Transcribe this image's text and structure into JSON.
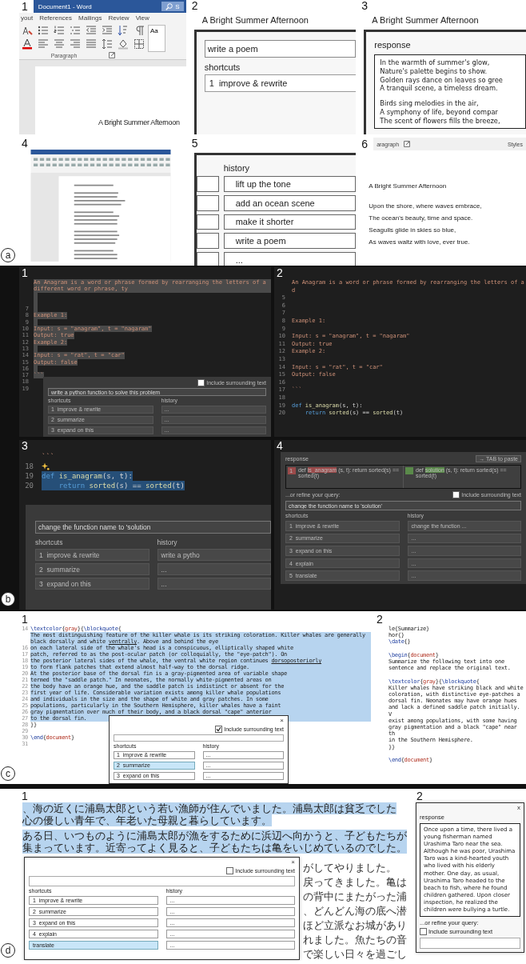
{
  "sections": [
    {
      "letter": "a",
      "panels": [
        {
          "number": "1",
          "kind": "word_window",
          "title": "Document1  -  Word",
          "search": "S",
          "tabs": [
            "yout",
            "References",
            "Mailings",
            "Review",
            "View"
          ],
          "group_label": "Paragraph",
          "style_preview": "Aa",
          "doc_title": "A Bright Summer Afternoon"
        },
        {
          "number": "2",
          "kind": "doc_dialog",
          "doc_title": "A Bright Summer Afternoon",
          "dialog": {
            "query": "write a poem",
            "shortcuts_label": "shortcuts",
            "shortcuts": [
              {
                "number": "1",
                "label": "improve & rewrite",
                "selected": false
              }
            ]
          }
        },
        {
          "number": "3",
          "kind": "doc_dialog",
          "doc_title": "A Bright Summer Afternoon",
          "dialog": {
            "response_label": "response",
            "response_stanzas": [
              [
                "In the warmth of summer's glow,",
                "Nature's palette begins to show.",
                "Golden rays dance on leaves so gree",
                "A tranquil scene, a timeless dream."
              ],
              [
                "Birds sing melodies in the air,",
                "A symphony of life, beyond compar",
                "The scent of flowers fills the breeze,"
              ]
            ]
          }
        },
        {
          "number": "4",
          "kind": "word_thumbnail"
        },
        {
          "number": "5",
          "kind": "doc_dialog",
          "dialog": {
            "history_label": "history",
            "shortcuts": [
              {
                "selected": false
              },
              {
                "selected": false
              },
              {
                "selected": false
              },
              {
                "selected": false
              },
              {
                "selected": false
              }
            ],
            "history": [
              "lift up the tone",
              "add an ocean scene",
              "make it shorter",
              "write a poem",
              "..."
            ]
          }
        },
        {
          "number": "6",
          "kind": "word_result",
          "ribbon_labels": [
            "aragraph",
            "Styles"
          ],
          "doc_title": "A Bright Summer Afternoon",
          "lines": [
            "Upon the shore, where waves embrace,",
            "The ocean's beauty, time and space.",
            "Seagulls glide in skies so blue,",
            "As waves waltz with love, ever true."
          ]
        }
      ]
    },
    {
      "letter": "b",
      "panels": [
        {
          "number": "1",
          "kind": "code_editor",
          "lines": [
            {
              "kind": "code",
              "selected": true,
              "parts": [
                {
                  "kind": "string",
                  "text": "An Anagram is a word or phrase formed by rearranging the letters of a different word or phrase, ty"
                }
              ]
            },
            {
              "kind": "code",
              "selected": true
            },
            {
              "kind": "code",
              "selected": true
            },
            {
              "kind": "code",
              "n": "7",
              "selected": true
            },
            {
              "kind": "code",
              "n": "8",
              "selected": true,
              "parts": [
                {
                  "kind": "string",
                  "text": "Example 1:"
                }
              ]
            },
            {
              "kind": "code",
              "n": "9",
              "selected": true
            },
            {
              "kind": "code",
              "n": "10",
              "selected": true,
              "parts": [
                {
                  "kind": "string",
                  "text": "Input: s = \"anagram\", t = \"nagaram\""
                }
              ]
            },
            {
              "kind": "code",
              "n": "11",
              "selected": true,
              "parts": [
                {
                  "kind": "string",
                  "text": "Output: true"
                }
              ]
            },
            {
              "kind": "code",
              "n": "12",
              "selected": true,
              "parts": [
                {
                  "kind": "string",
                  "text": "Example 2:"
                }
              ]
            },
            {
              "kind": "code",
              "n": "13",
              "selected": true
            },
            {
              "kind": "code",
              "n": "14",
              "selected": true,
              "parts": [
                {
                  "kind": "string",
                  "text": "Input: s = \"rat\", t = \"car\""
                }
              ]
            },
            {
              "kind": "code",
              "n": "15",
              "selected": true,
              "parts": [
                {
                  "kind": "string",
                  "text": "Output: false"
                }
              ]
            },
            {
              "kind": "code",
              "n": "16",
              "selected": true
            },
            {
              "kind": "code",
              "n": "17",
              "selected": true,
              "parts": [
                {
                  "kind": "string",
                  "text": "```"
                }
              ]
            },
            {
              "kind": "code",
              "n": "18",
              "selected": false
            },
            {
              "kind": "code",
              "n": "19",
              "selected": false
            }
          ],
          "dialog": {
            "include": {
              "label": "Include surrounding text",
              "checked": false
            },
            "query": "write a python function to solve this problem",
            "shortcuts_label": "shortcuts",
            "history_label": "history",
            "shortcuts": [
              {
                "number": "1",
                "label": "improve & rewrite",
                "selected": false
              },
              {
                "number": "2",
                "label": "summarize",
                "selected": false
              },
              {
                "number": "3",
                "label": "expand on this",
                "selected": false
              }
            ],
            "history": [
              "...",
              "...",
              "..."
            ]
          }
        },
        {
          "number": "2",
          "kind": "code_editor",
          "lines": [
            {
              "kind": "code",
              "selected": false,
              "parts": [
                {
                  "kind": "string",
                  "text": "An Anagram is a word or phrase formed by rearranging the letters of a d"
                }
              ]
            },
            {
              "kind": "code",
              "n": "5",
              "selected": false
            },
            {
              "kind": "code",
              "n": "6",
              "selected": false
            },
            {
              "kind": "code",
              "n": "7",
              "selected": false
            },
            {
              "kind": "code",
              "n": "8",
              "selected": false,
              "parts": [
                {
                  "kind": "string",
                  "text": "Example 1:"
                }
              ]
            },
            {
              "kind": "code",
              "n": "9",
              "selected": false
            },
            {
              "kind": "code",
              "n": "10",
              "selected": false,
              "parts": [
                {
                  "kind": "string",
                  "text": "Input: s = \"anagram\", t = \"nagaram\""
                }
              ]
            },
            {
              "kind": "code",
              "n": "11",
              "selected": false,
              "parts": [
                {
                  "kind": "string",
                  "text": "Output: true"
                }
              ]
            },
            {
              "kind": "code",
              "n": "12",
              "selected": false,
              "parts": [
                {
                  "kind": "string",
                  "text": "Example 2:"
                }
              ]
            },
            {
              "kind": "code",
              "n": "13",
              "selected": false
            },
            {
              "kind": "code",
              "n": "14",
              "selected": false,
              "parts": [
                {
                  "kind": "string",
                  "text": "Input: s = \"rat\", t = \"car\""
                }
              ]
            },
            {
              "kind": "code",
              "n": "15",
              "selected": false,
              "parts": [
                {
                  "kind": "string",
                  "text": "Output: false"
                }
              ]
            },
            {
              "kind": "code",
              "n": "16",
              "selected": false
            },
            {
              "kind": "code",
              "n": "17",
              "selected": false,
              "parts": [
                {
                  "kind": "string",
                  "text": "```"
                }
              ]
            },
            {
              "kind": "code",
              "n": "18",
              "selected": false
            },
            {
              "kind": "code",
              "n": "19",
              "selected": false,
              "parts": [
                {
                  "kind": "keyword",
                  "text": "def "
                },
                {
                  "kind": "function",
                  "text": "is_anagram"
                },
                {
                  "kind": "plain",
                  "text": "(s, t):"
                }
              ]
            },
            {
              "kind": "code",
              "n": "20",
              "selected": false,
              "parts": [
                {
                  "kind": "keyword",
                  "text": "    return"
                },
                {
                  "kind": "function",
                  "text": " sorted"
                },
                {
                  "kind": "plain",
                  "text": "(s) == "
                },
                {
                  "kind": "function",
                  "text": "sorted"
                },
                {
                  "kind": "plain",
                  "text": "(t)"
                }
              ]
            }
          ]
        },
        {
          "number": "3",
          "kind": "code_editor",
          "lines": [
            {
              "kind": "code",
              "selected": false,
              "parts": [
                {
                  "kind": "string",
                  "text": "```"
                }
              ]
            },
            {
              "kind": "suggestion",
              "n": "18",
              "selected": false
            },
            {
              "kind": "code",
              "n": "19",
              "selected": true,
              "parts": [
                {
                  "kind": "keyword",
                  "text": "def "
                },
                {
                  "kind": "function",
                  "text": "is_anagram"
                },
                {
                  "kind": "plain",
                  "text": "(s, t):"
                }
              ]
            },
            {
              "kind": "code",
              "n": "20",
              "selected": true,
              "parts": [
                {
                  "kind": "keyword",
                  "text": "    return"
                },
                {
                  "kind": "function",
                  "text": " sorted"
                },
                {
                  "kind": "plain",
                  "text": "(s) == "
                },
                {
                  "kind": "function",
                  "text": "sorted"
                },
                {
                  "kind": "plain",
                  "text": "(t)"
                }
              ]
            }
          ],
          "dialog": {
            "query": "change the function name to 'solution",
            "shortcuts_label": "shortcuts",
            "history_label": "history",
            "shortcuts": [
              {
                "number": "1",
                "label": "improve & rewrite",
                "selected": false
              },
              {
                "number": "2",
                "label": "summarize",
                "selected": false
              },
              {
                "number": "3",
                "label": "expand on this",
                "selected": false
              }
            ],
            "history": [
              "write a pytho",
              "...",
              "..."
            ]
          }
        },
        {
          "number": "4",
          "kind": "diff_dialog",
          "dialog": {
            "response_label": "response",
            "paste_button": "→ TAB to paste",
            "diff": [
              {
                "kind": "removed",
                "line_number": "1",
                "before": "def ",
                "changed": "is_anagram",
                "after": " (s, t):     return sorted(s) == sorted(t)"
              },
              {
                "kind": "added",
                "before": "def ",
                "changed": "solution",
                "after": " (s, t):     return sorted(s) == sorted(t)"
              }
            ],
            "refine_label": "...or refine your query:",
            "include": {
              "label": "Include surrounding text",
              "checked": false
            },
            "query": "change the function name to 'solution'",
            "shortcuts_label": "shortcuts",
            "history_label": "history",
            "shortcuts": [
              {
                "number": "1",
                "label": "improve & rewrite",
                "selected": false
              },
              {
                "number": "2",
                "label": "summarize",
                "selected": false
              },
              {
                "number": "3",
                "label": "expand on this",
                "selected": false
              },
              {
                "number": "4",
                "label": "explain",
                "selected": false
              },
              {
                "number": "5",
                "label": "translate",
                "selected": false
              }
            ],
            "history": [
              "change the function ...",
              "...",
              "...",
              "...",
              "..."
            ]
          }
        }
      ]
    },
    {
      "letter": "c",
      "panels": [
        {
          "number": "1",
          "kind": "latex_editor",
          "lines": [
            {
              "n": "14",
              "selected": false,
              "parts": [
                {
                  "kind": "command",
                  "text": "\\textcolor"
                },
                {
                  "kind": "plain",
                  "text": "{"
                },
                {
                  "kind": "arg",
                  "text": "gray"
                },
                {
                  "kind": "plain",
                  "text": "}{"
                },
                {
                  "kind": "command",
                  "text": "\\blockquote"
                },
                {
                  "kind": "plain",
                  "text": "{"
                }
              ]
            },
            {
              "selected": true,
              "parts": [
                {
                  "kind": "plain",
                  "text": "The most distinguishing feature of the killer whale is its striking coloration. Killer whales are generally"
                }
              ]
            },
            {
              "selected": true,
              "parts": [
                {
                  "kind": "plain",
                  "text": "black dorsally and white "
                },
                {
                  "kind": "misspelled",
                  "text": "ventrally"
                },
                {
                  "kind": "plain",
                  "text": ". Above and behind the eye"
                }
              ]
            },
            {
              "n": "16",
              "selected": true,
              "parts": [
                {
                  "kind": "plain",
                  "text": "on each lateral side of the whale's head is a conspicuous, elliptically shaped white"
                }
              ]
            },
            {
              "n": "17",
              "selected": true,
              "parts": [
                {
                  "kind": "plain",
                  "text": "patch, referred to as the post-ocular patch (or colloquially, the \"eye-patch\"). On"
                }
              ]
            },
            {
              "n": "18",
              "selected": true,
              "parts": [
                {
                  "kind": "plain",
                  "text": "the posterior lateral sides of the whale, the ventral white region continues "
                },
                {
                  "kind": "misspelled",
                  "text": "dorsoposteriorly"
                }
              ]
            },
            {
              "n": "19",
              "selected": true,
              "parts": [
                {
                  "kind": "plain",
                  "text": "to form flank patches that extend almost half-way to the dorsal ridge."
                }
              ]
            },
            {
              "n": "20",
              "selected": true,
              "parts": [
                {
                  "kind": "plain",
                  "text": "At the posterior base of the dorsal fin is a gray-pigmented area of variable shape"
                }
              ]
            },
            {
              "n": "21",
              "selected": true,
              "parts": [
                {
                  "kind": "plain",
                  "text": "termed the \"saddle patch.\" In neonates, the normally white-pigmented areas on"
                }
              ]
            },
            {
              "n": "22",
              "selected": true,
              "parts": [
                {
                  "kind": "plain",
                  "text": "the body have an orange hue, and the saddle patch is indistinct or absent for the"
                }
              ]
            },
            {
              "n": "23",
              "selected": true,
              "parts": [
                {
                  "kind": "plain",
                  "text": "first year of life. Considerable variation exists among killer whale populations"
                }
              ]
            },
            {
              "n": "24",
              "selected": true,
              "parts": [
                {
                  "kind": "plain",
                  "text": "and individuals in the size and the shape of white and gray patches. In some"
                }
              ]
            },
            {
              "n": "25",
              "selected": true,
              "parts": [
                {
                  "kind": "plain",
                  "text": "populations, particularly in the Southern Hemisphere, killer whales have a faint"
                }
              ]
            },
            {
              "n": "26",
              "selected": true,
              "parts": [
                {
                  "kind": "plain",
                  "text": "gray pigmentation over much of their body, and a black dorsal \"cape\" anterior"
                }
              ]
            },
            {
              "n": "27",
              "selected": true,
              "parts": [
                {
                  "kind": "plain",
                  "text": "to the dorsal fin."
                }
              ]
            },
            {
              "n": "28",
              "selected": false,
              "parts": [
                {
                  "kind": "plain",
                  "text": "}}"
                }
              ]
            },
            {
              "n": "29",
              "selected": false
            },
            {
              "n": "30",
              "selected": false,
              "parts": [
                {
                  "kind": "command",
                  "text": "\\end"
                },
                {
                  "kind": "plain",
                  "text": "{"
                },
                {
                  "kind": "arg",
                  "text": "document"
                },
                {
                  "kind": "plain",
                  "text": "}"
                }
              ]
            },
            {
              "n": "31",
              "selected": false
            }
          ],
          "dialog": {
            "close": "×",
            "include": {
              "label": "Include surrounding text",
              "checked": true
            },
            "query_field": true,
            "shortcuts_label": "shortcuts",
            "history_label": "history",
            "shortcuts": [
              {
                "number": "1",
                "label": "improve & rewrite",
                "selected": false
              },
              {
                "number": "2",
                "label": "summarize",
                "selected": true
              },
              {
                "number": "3",
                "label": "expand on this",
                "selected": false
              }
            ],
            "history": [
              "...",
              "...",
              "..."
            ]
          }
        },
        {
          "number": "2",
          "kind": "latex_editor",
          "blocks": [
            [
              {
                "parts": [
                  {
                    "kind": "plain",
                    "text": "le{Summarize}"
                  }
                ]
              },
              {
                "parts": [
                  {
                    "kind": "plain",
                    "text": "hor{}"
                  }
                ]
              },
              {
                "parts": [
                  {
                    "kind": "command",
                    "text": "\\date"
                  },
                  {
                    "kind": "plain",
                    "text": "{}"
                  }
                ]
              }
            ],
            [
              {
                "parts": [
                  {
                    "kind": "command",
                    "text": "\\begin"
                  },
                  {
                    "kind": "plain",
                    "text": "{"
                  },
                  {
                    "kind": "arg",
                    "text": "document"
                  },
                  {
                    "kind": "plain",
                    "text": "}"
                  }
                ]
              },
              {
                "parts": [
                  {
                    "kind": "plain",
                    "text": "Summarize the following text into one sentence and replace the original text."
                  }
                ]
              }
            ],
            [
              {
                "parts": [
                  {
                    "kind": "command",
                    "text": "\\textcolor"
                  },
                  {
                    "kind": "plain",
                    "text": "{"
                  },
                  {
                    "kind": "arg",
                    "text": "gray"
                  },
                  {
                    "kind": "plain",
                    "text": "}{"
                  },
                  {
                    "kind": "command",
                    "text": "\\blockquote"
                  },
                  {
                    "kind": "plain",
                    "text": "{"
                  }
                ]
              },
              {
                "parts": [
                  {
                    "kind": "plain",
                    "text": "Killer whales have striking black and white coloration, with distinctive eye-patches a"
                  }
                ]
              },
              {
                "parts": [
                  {
                    "kind": "plain",
                    "text": "dorsal fin. Neonates may have orange hues and lack a defined saddle patch initially. V"
                  }
                ]
              },
              {
                "parts": [
                  {
                    "kind": "plain",
                    "text": "exist among populations, with some having gray pigmentation and a black \"cape\" near th"
                  }
                ]
              },
              {
                "parts": [
                  {
                    "kind": "plain",
                    "text": "in the Southern Hemisphere."
                  }
                ]
              },
              {
                "parts": [
                  {
                    "kind": "plain",
                    "text": "}}"
                  }
                ]
              }
            ],
            [
              {
                "parts": [
                  {
                    "kind": "command",
                    "text": "\\end"
                  },
                  {
                    "kind": "plain",
                    "text": "{"
                  },
                  {
                    "kind": "arg",
                    "text": "document"
                  },
                  {
                    "kind": "plain",
                    "text": "}"
                  }
                ]
              }
            ]
          ]
        }
      ]
    },
    {
      "letter": "d",
      "panels": [
        {
          "number": "1",
          "kind": "jp_editor",
          "paragraphs": [
            {
              "selected": true,
              "lines": [
                "、海の近くに浦島太郎という若い漁師が住んでいました。浦島太郎は貧乏でした",
                "心の優しい青年で、年老いた母親と暮らしています。"
              ]
            },
            {
              "selected": true,
              "lines": [
                "ある日、いつものように浦島太郎が漁をするために浜辺へ向かうと、子どもたちが",
                "集まっています。近寄ってよく見ると、子どもたちは亀をいじめているのでした。"
              ]
            }
          ],
          "side_text": [
            "がしてやりました。",
            "戻ってきました。亀は",
            "の背中にまたがった浦",
            "、どんどん海の底へ潜",
            "ほど立派なお城があり",
            "れました。魚たちの音",
            "で楽しい日々を過ごし"
          ],
          "dialog": {
            "close": "×",
            "include": {
              "label": "Include surrounding text",
              "checked": false
            },
            "query_field": true,
            "shortcuts_label": "shortcuts",
            "history_label": "history",
            "shortcuts": [
              {
                "number": "1",
                "label": "improve & rewrite",
                "selected": false
              },
              {
                "number": "2",
                "label": "summarize",
                "selected": false
              },
              {
                "number": "3",
                "label": "expand on this",
                "selected": false
              },
              {
                "number": "4",
                "label": "explain",
                "selected": false
              },
              {
                "label": "translate",
                "selected": true
              }
            ],
            "history": [
              "...",
              "...",
              "...",
              "...",
              "..."
            ]
          }
        },
        {
          "number": "2",
          "kind": "response_dialog",
          "dialog": {
            "close": "x",
            "response_label": "response",
            "response_text": "Once upon a time, there lived a young fisherman named Urashima Taro near the sea. Although he was poor, Urashima Taro was a kind-hearted youth who lived with his elderly mother. One day, as usual, Urashima Taro headed to the beach to fish, where he found children gathered. Upon closer inspection, he realized the children were bullying a turtle.",
            "refine_label": "...or refine your query:",
            "include": {
              "label": "Include surrounding text",
              "checked": false
            },
            "query_field": true
          }
        }
      ]
    }
  ]
}
